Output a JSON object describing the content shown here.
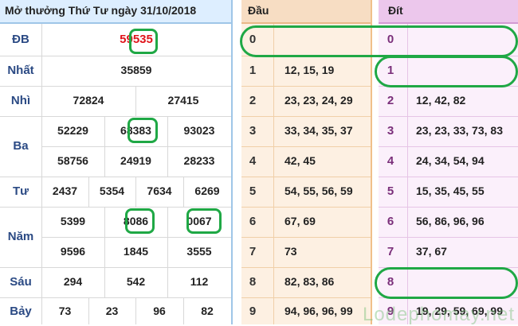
{
  "results": {
    "header": "Mở thưởng Thứ Tư ngày 31/10/2018",
    "rows": [
      {
        "label": "ĐB",
        "values": [
          "59535"
        ]
      },
      {
        "label": "Nhất",
        "values": [
          "35859"
        ]
      },
      {
        "label": "Nhì",
        "values": [
          "72824",
          "27415"
        ]
      },
      {
        "label": "Ba",
        "values": [
          "52229",
          "68383",
          "93023",
          "58756",
          "24919",
          "28233"
        ]
      },
      {
        "label": "Tư",
        "values": [
          "2437",
          "5354",
          "7634",
          "6269"
        ]
      },
      {
        "label": "Năm",
        "values": [
          "5399",
          "8086",
          "0067",
          "9596",
          "1845",
          "3555"
        ]
      },
      {
        "label": "Sáu",
        "values": [
          "294",
          "542",
          "112"
        ]
      },
      {
        "label": "Bảy",
        "values": [
          "73",
          "23",
          "96",
          "82"
        ]
      }
    ],
    "db_prefix": "59",
    "db_suffix": "535"
  },
  "dau": {
    "header": "Đầu",
    "rows": [
      {
        "digit": "0",
        "values": ""
      },
      {
        "digit": "1",
        "values": "12, 15, 19"
      },
      {
        "digit": "2",
        "values": "23, 23, 24, 29"
      },
      {
        "digit": "3",
        "values": "33, 34, 35, 37"
      },
      {
        "digit": "4",
        "values": "42, 45"
      },
      {
        "digit": "5",
        "values": "54, 55, 56, 59"
      },
      {
        "digit": "6",
        "values": "67, 69"
      },
      {
        "digit": "7",
        "values": "73"
      },
      {
        "digit": "8",
        "values": "82, 83, 86"
      },
      {
        "digit": "9",
        "values": "94, 96, 96, 99"
      }
    ]
  },
  "dit": {
    "header": "Đít",
    "rows": [
      {
        "digit": "0",
        "values": ""
      },
      {
        "digit": "1",
        "values": ""
      },
      {
        "digit": "2",
        "values": "12, 42, 82"
      },
      {
        "digit": "3",
        "values": "23, 23, 33, 73, 83"
      },
      {
        "digit": "4",
        "values": "24, 34, 54, 94"
      },
      {
        "digit": "5",
        "values": "15, 35, 45, 55"
      },
      {
        "digit": "6",
        "values": "56, 86, 96, 96"
      },
      {
        "digit": "7",
        "values": "37, 67"
      },
      {
        "digit": "8",
        "values": ""
      },
      {
        "digit": "9",
        "values": "19, 29, 59, 69, 99"
      }
    ]
  },
  "watermark": "Lodephomay.net",
  "colors": {
    "accent_red": "#e0141b",
    "label_blue": "#2b4a84",
    "highlight_green": "#1fa845",
    "dau_bg": "#fdf0e2",
    "dit_bg": "#fbf0fb"
  }
}
